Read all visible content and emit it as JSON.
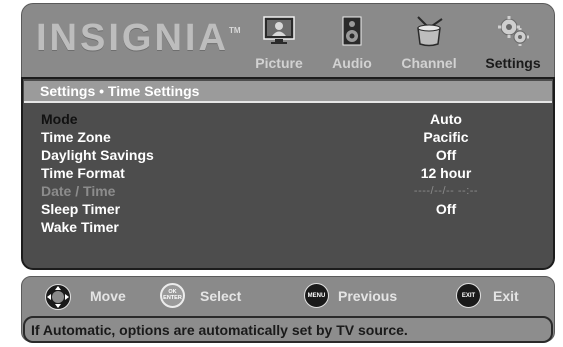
{
  "header": {
    "logo": "INSIGNIA",
    "logo_tm": "TM",
    "tabs": [
      {
        "label": "Picture",
        "icon": "picture-icon",
        "active": false
      },
      {
        "label": "Audio",
        "icon": "audio-icon",
        "active": false
      },
      {
        "label": "Channel",
        "icon": "channel-icon",
        "active": false
      },
      {
        "label": "Settings",
        "icon": "settings-icon",
        "active": true
      }
    ]
  },
  "panel": {
    "breadcrumb": "Settings • Time Settings",
    "rows": [
      {
        "label": "Mode",
        "value": "Auto",
        "state": "selected"
      },
      {
        "label": "Time Zone",
        "value": "Pacific",
        "state": "normal"
      },
      {
        "label": "Daylight Savings",
        "value": "Off",
        "state": "normal"
      },
      {
        "label": "Time Format",
        "value": "12 hour",
        "state": "normal"
      },
      {
        "label": "Date / Time",
        "value": "----/--/-- --:--",
        "state": "disabled"
      },
      {
        "label": "Sleep Timer",
        "value": "Off",
        "state": "normal"
      },
      {
        "label": "Wake Timer",
        "value": "",
        "state": "normal"
      }
    ]
  },
  "footer": {
    "hints": [
      {
        "label": "Move",
        "button": "",
        "icon": "dpad-icon"
      },
      {
        "label": "Select",
        "button": "OK ENTER",
        "icon": "ok-enter-button-icon"
      },
      {
        "label": "Previous",
        "button": "MENU",
        "icon": "menu-button-icon"
      },
      {
        "label": "Exit",
        "button": "EXIT",
        "icon": "exit-button-icon"
      }
    ],
    "help_text": "If Automatic, options are automatically set by TV source."
  },
  "colors": {
    "header_bg": "#8a8a8a",
    "panel_bg": "#4d4d4d",
    "breadcrumb_bg": "#9b9b9b",
    "disabled_text": "#8c8c8c"
  }
}
